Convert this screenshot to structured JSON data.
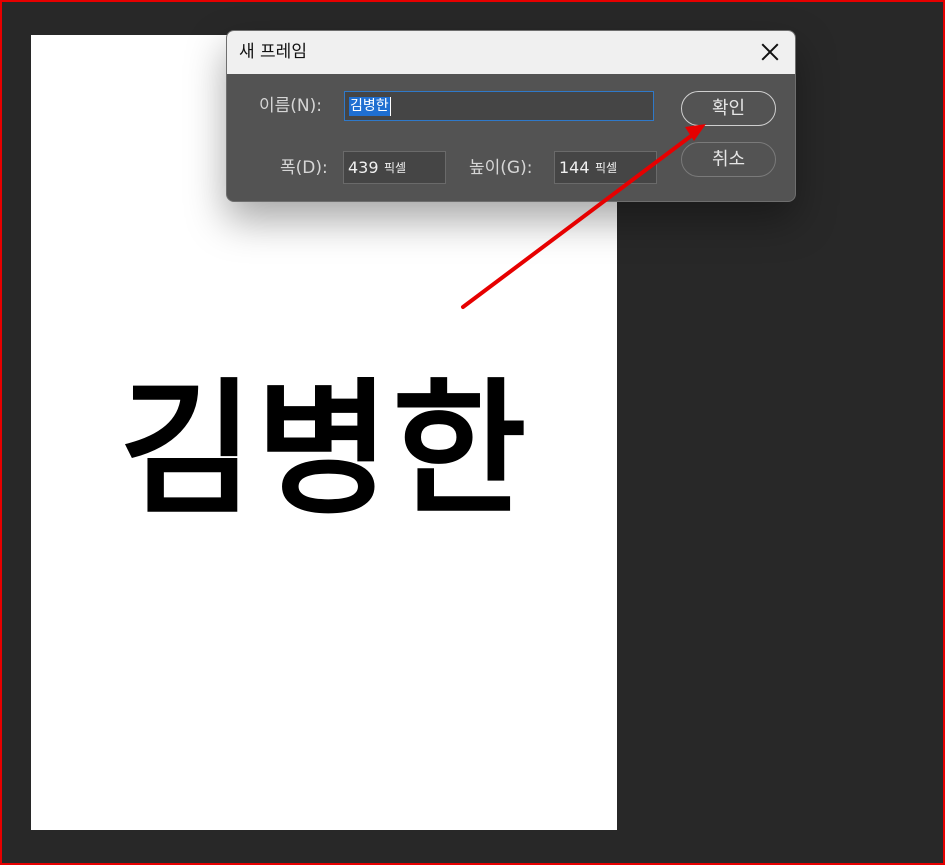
{
  "canvas": {
    "text": "김병한"
  },
  "dialog": {
    "title": "새 프레임",
    "name_label": "이름(N):",
    "name_value": "김병한",
    "width_label": "폭(D):",
    "width_value": "439",
    "width_unit": "픽셀",
    "height_label": "높이(G):",
    "height_value": "144",
    "height_unit": "픽셀",
    "ok_label": "확인",
    "cancel_label": "취소"
  },
  "colors": {
    "background": "#282828",
    "annotation": "#e60000",
    "selection": "#1f6fd1",
    "dialog_body": "#535353"
  },
  "icons": [
    "close-icon"
  ]
}
